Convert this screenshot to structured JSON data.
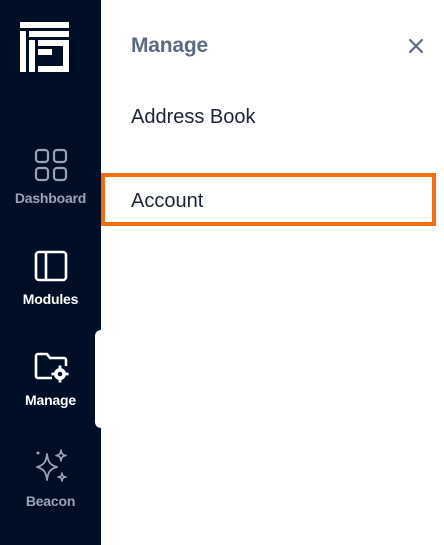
{
  "sidebar": {
    "logo": "app-logo",
    "items": [
      {
        "label": "Dashboard",
        "icon": "grid-icon",
        "state": "inactive"
      },
      {
        "label": "Modules",
        "icon": "panel-icon",
        "state": "inactive"
      },
      {
        "label": "Manage",
        "icon": "folder-gear-icon",
        "state": "active"
      },
      {
        "label": "Beacon",
        "icon": "sparkle-icon",
        "state": "inactive"
      }
    ]
  },
  "panel": {
    "title": "Manage",
    "close_icon": "close-icon",
    "items": [
      {
        "label": "Address Book"
      },
      {
        "label": "Account",
        "highlighted": true
      }
    ]
  },
  "colors": {
    "rail_bg": "#000f26",
    "highlight_border": "#f26f10",
    "title": "#5c6a86",
    "item_text": "#1c2437"
  }
}
